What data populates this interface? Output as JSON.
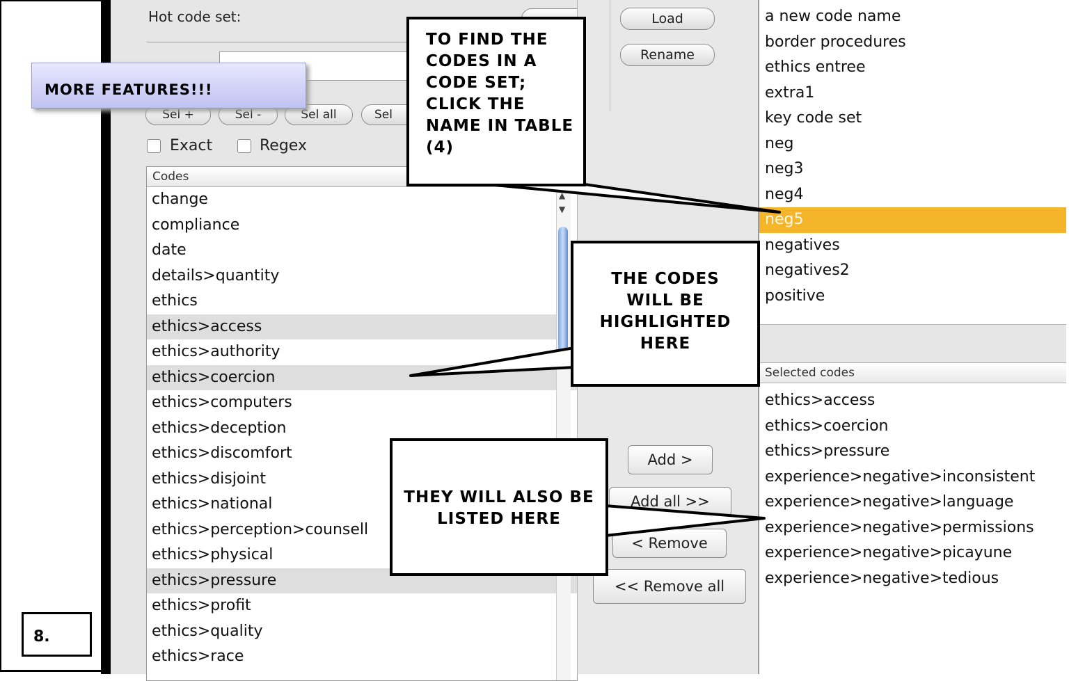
{
  "left_panel": {
    "hot_code_set_label": "Hot code set:",
    "select_buttons": [
      "Sel +",
      "Sel -",
      "Sel all",
      "Sel"
    ],
    "exact_label": "Exact",
    "regex_label": "Regex",
    "codes_header": "Codes",
    "codes": [
      {
        "label": "change",
        "selected": false
      },
      {
        "label": "compliance",
        "selected": false
      },
      {
        "label": "date",
        "selected": false
      },
      {
        "label": "details>quantity",
        "selected": false
      },
      {
        "label": "ethics",
        "selected": false
      },
      {
        "label": "ethics>access",
        "selected": true
      },
      {
        "label": "ethics>authority",
        "selected": false
      },
      {
        "label": "ethics>coercion",
        "selected": true
      },
      {
        "label": "ethics>computers",
        "selected": false
      },
      {
        "label": "ethics>deception",
        "selected": false
      },
      {
        "label": "ethics>discomfort",
        "selected": false
      },
      {
        "label": "ethics>disjoint",
        "selected": false
      },
      {
        "label": "ethics>national",
        "selected": false
      },
      {
        "label": "ethics>perception>counsell",
        "selected": false
      },
      {
        "label": "ethics>physical",
        "selected": false
      },
      {
        "label": "ethics>pressure",
        "selected": true
      },
      {
        "label": "ethics>profit",
        "selected": false
      },
      {
        "label": "ethics>quality",
        "selected": false
      },
      {
        "label": "ethics>race",
        "selected": false
      }
    ]
  },
  "middle_panel": {
    "load_label": "Load",
    "rename_label": "Rename",
    "add_label": "Add >",
    "add_all_label": "Add all >>",
    "remove_label": "< Remove",
    "remove_all_label": "<< Remove all"
  },
  "right_panel": {
    "code_sets": [
      {
        "label": "a new code name",
        "highlighted": false
      },
      {
        "label": "border procedures",
        "highlighted": false
      },
      {
        "label": "ethics entree",
        "highlighted": false
      },
      {
        "label": "extra1",
        "highlighted": false
      },
      {
        "label": "key code set",
        "highlighted": false
      },
      {
        "label": "neg",
        "highlighted": false
      },
      {
        "label": "neg3",
        "highlighted": false
      },
      {
        "label": "neg4",
        "highlighted": false
      },
      {
        "label": "neg5",
        "highlighted": true
      },
      {
        "label": "negatives",
        "highlighted": false
      },
      {
        "label": "negatives2",
        "highlighted": false
      },
      {
        "label": "positive",
        "highlighted": false
      }
    ],
    "selected_codes_header": "Selected codes",
    "selected_codes": [
      "ethics>access",
      "ethics>coercion",
      "ethics>pressure",
      "experience>negative>inconsistent",
      "experience>negative>language",
      "experience>negative>permissions",
      "experience>negative>picayune",
      "experience>negative>tedious"
    ]
  },
  "annotations": {
    "more_features": "MORE FEATURES!!!",
    "find_codes": "TO FIND THE CODES IN A CODE SET; CLICK THE NAME IN TABLE (4)",
    "highlighted": "THE CODES WILL BE HIGHLIGHTED HERE",
    "listed": "THEY WILL ALSO BE LISTED HERE",
    "step_number": "8."
  },
  "colors": {
    "highlight_row": "#f4b52b",
    "selected_row": "#dedede",
    "pane_background": "#e6e6e6"
  }
}
